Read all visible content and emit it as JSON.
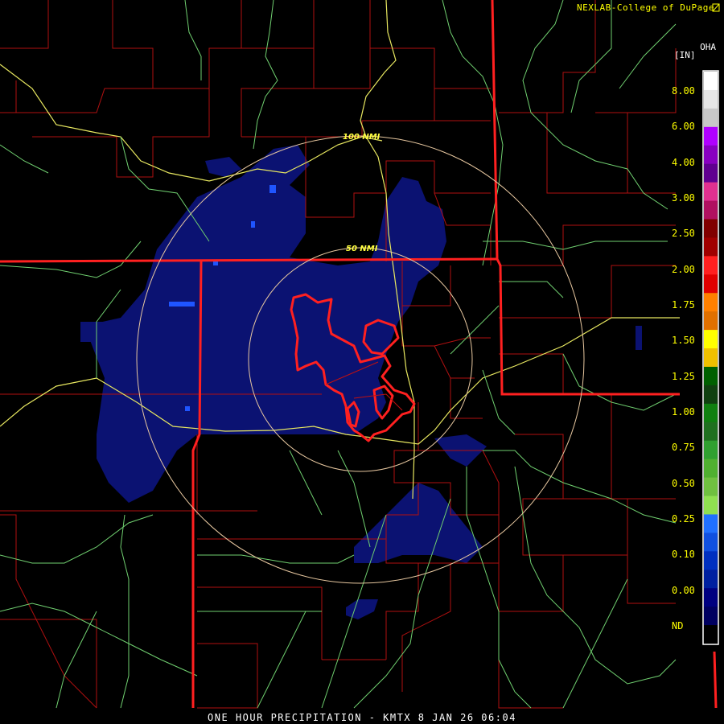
{
  "header": {
    "credit": "NEXLAB-College of DuPage",
    "product_code": "OHA",
    "units": "[IN]"
  },
  "legend": {
    "labels": [
      "8.00",
      "6.00",
      "4.00",
      "3.00",
      "2.50",
      "2.00",
      "1.75",
      "1.50",
      "1.25",
      "1.00",
      "0.75",
      "0.50",
      "0.25",
      "0.10",
      "0.00",
      "ND"
    ],
    "colors": [
      "#ffffff",
      "#e6e6e6",
      "#c8c8c8",
      "#b000ff",
      "#8800c0",
      "#600090",
      "#e03090",
      "#b01060",
      "#800000",
      "#a00000",
      "#ff2020",
      "#e00000",
      "#ff8000",
      "#e07000",
      "#ffff00",
      "#f0c000",
      "#006000",
      "#104010",
      "#108010",
      "#207020",
      "#30a030",
      "#50b030",
      "#70c040",
      "#90e050",
      "#2070ff",
      "#1050e0",
      "#0030c0",
      "#0020a0",
      "#000080",
      "#000060",
      "#000000"
    ]
  },
  "range_rings": [
    "100 NMI",
    "50 NMI"
  ],
  "warning_polygons": 3,
  "footer": {
    "title": "ONE HOUR PRECIPITATION - KMTX 8 JAN 26 06:04"
  }
}
